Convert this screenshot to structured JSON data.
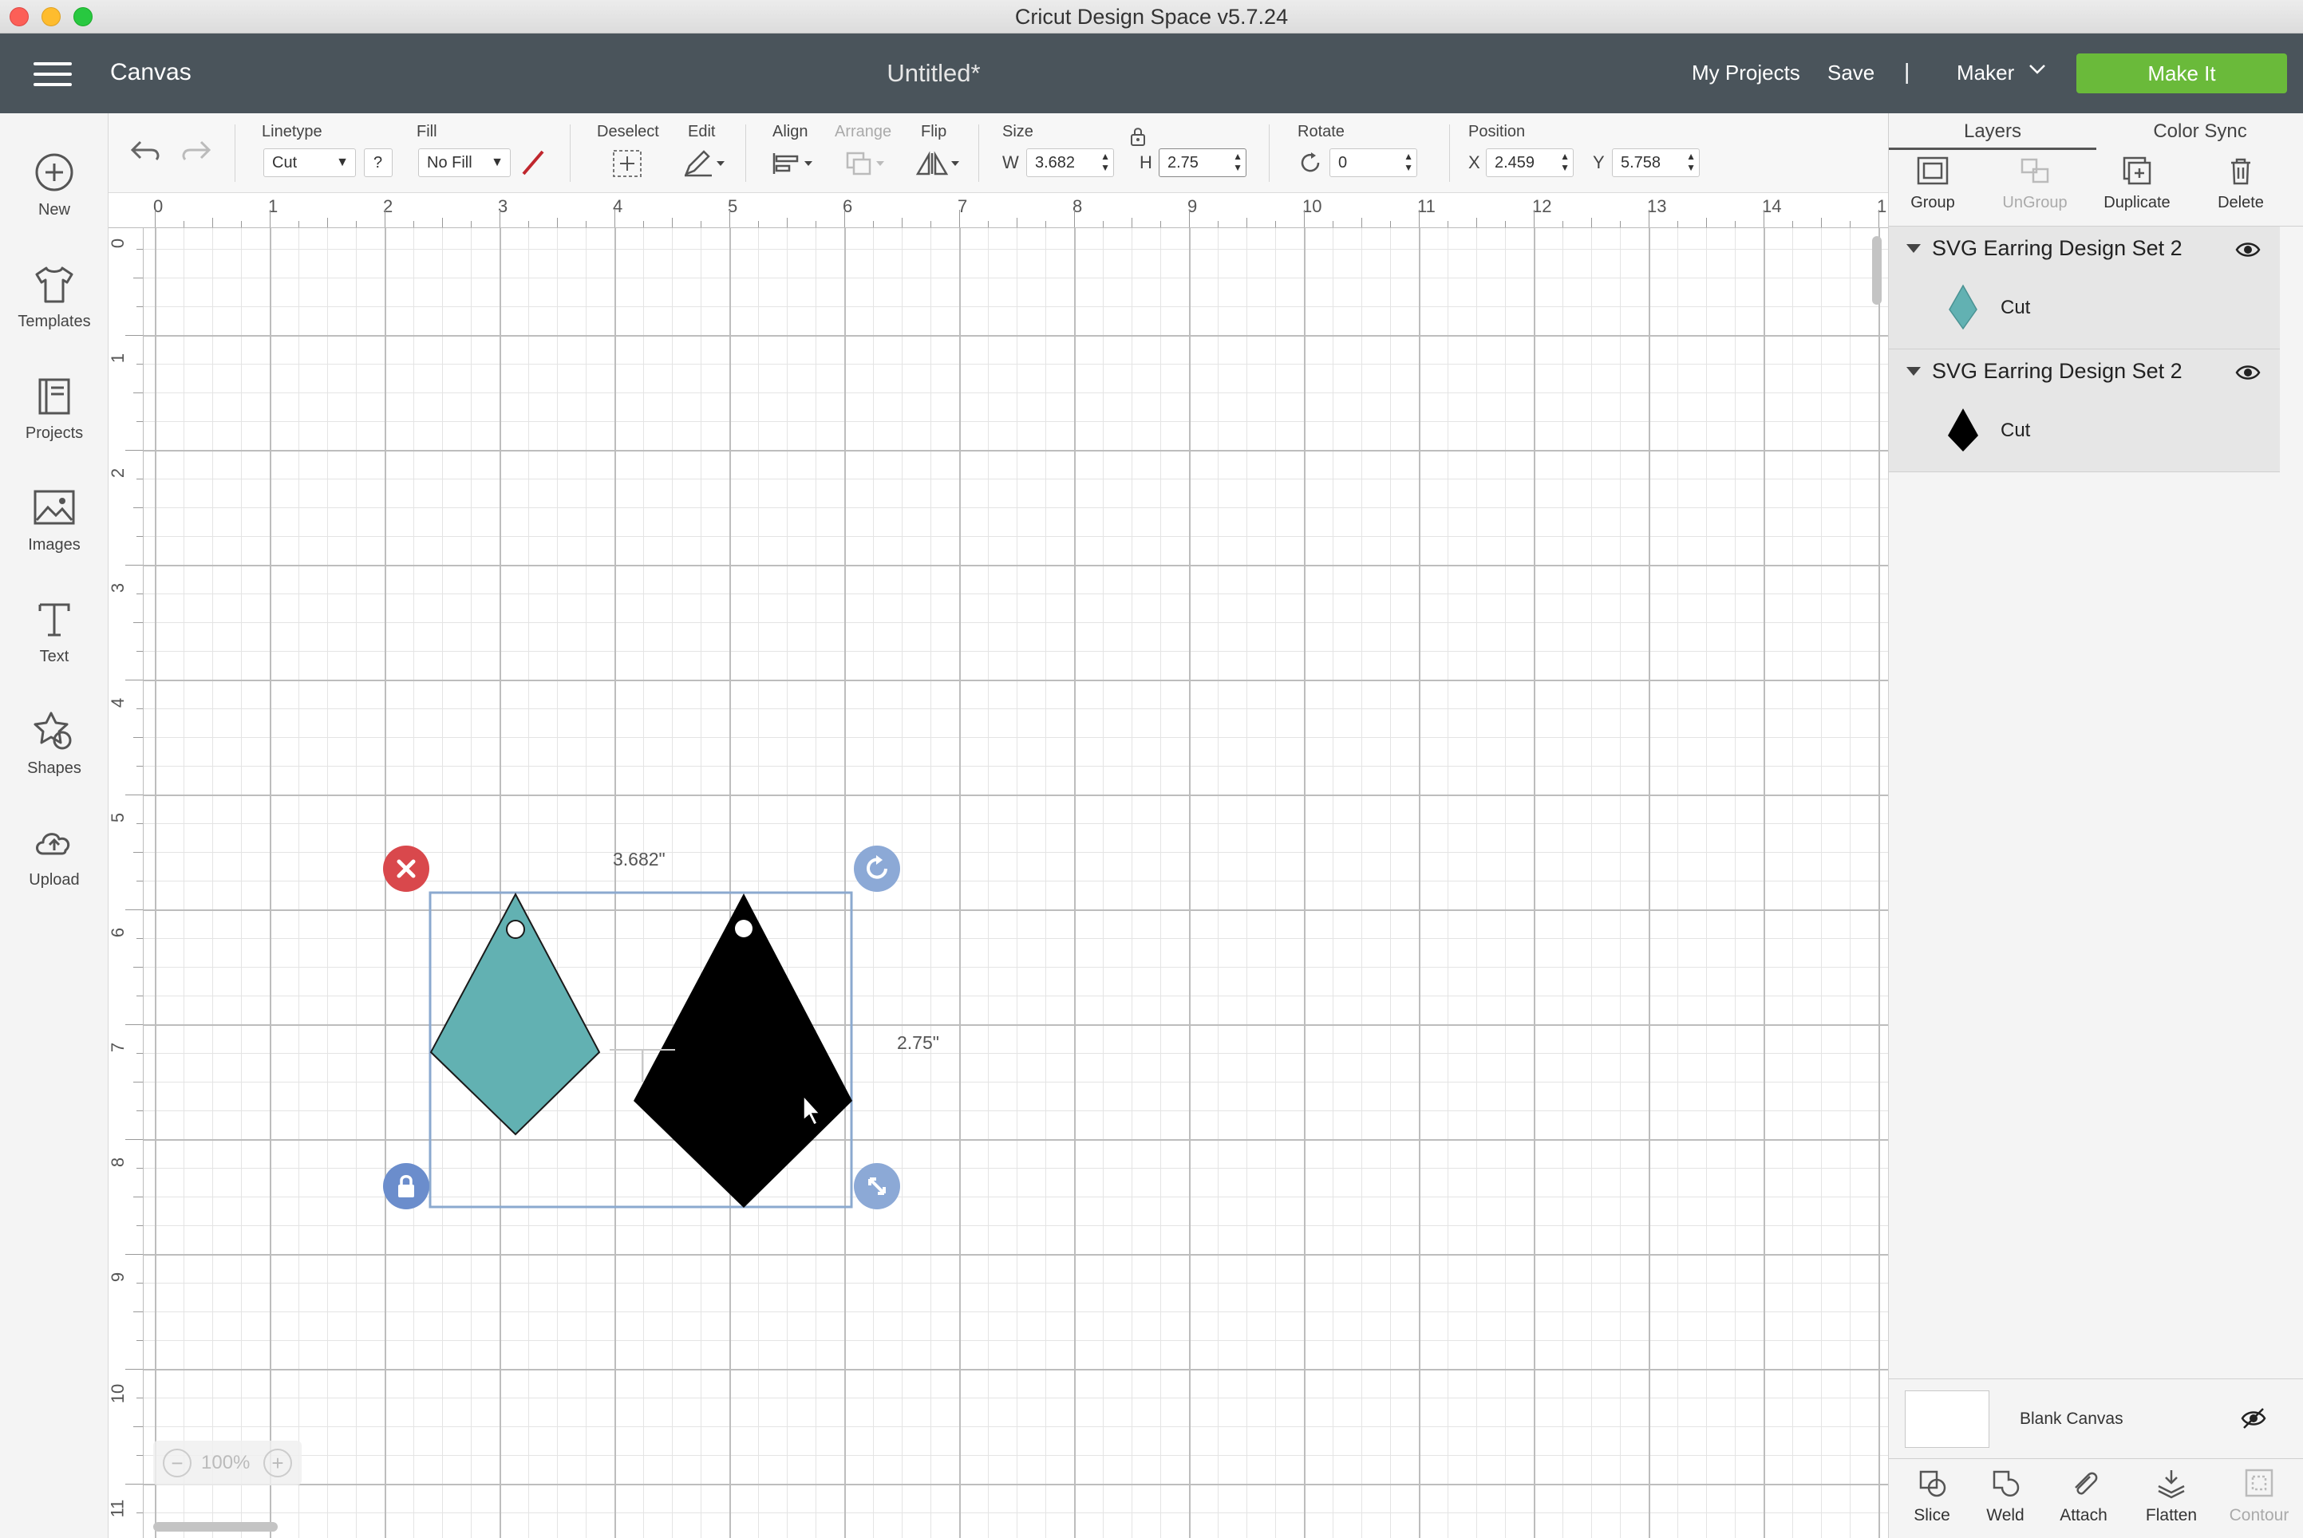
{
  "window": {
    "title": "Cricut Design Space  v5.7.24"
  },
  "header": {
    "section": "Canvas",
    "document_title": "Untitled*",
    "my_projects": "My Projects",
    "save": "Save",
    "separator": "|",
    "machine": "Maker",
    "make_it": "Make It"
  },
  "sidebar": {
    "items": [
      {
        "label": "New",
        "icon": "plus-circle-icon"
      },
      {
        "label": "Templates",
        "icon": "tshirt-icon"
      },
      {
        "label": "Projects",
        "icon": "projects-icon"
      },
      {
        "label": "Images",
        "icon": "image-icon"
      },
      {
        "label": "Text",
        "icon": "text-icon"
      },
      {
        "label": "Shapes",
        "icon": "shapes-icon"
      },
      {
        "label": "Upload",
        "icon": "cloud-upload-icon"
      }
    ]
  },
  "toolbar": {
    "linetype_label": "Linetype",
    "linetype_value": "Cut",
    "help": "?",
    "fill_label": "Fill",
    "fill_value": "No Fill",
    "deselect_label": "Deselect",
    "edit_label": "Edit",
    "align_label": "Align",
    "arrange_label": "Arrange",
    "flip_label": "Flip",
    "size_label": "Size",
    "w_label": "W",
    "w_value": "3.682",
    "h_label": "H",
    "h_value": "2.75",
    "rotate_label": "Rotate",
    "rotate_value": "0",
    "position_label": "Position",
    "x_label": "X",
    "x_value": "2.459",
    "y_label": "Y",
    "y_value": "5.758"
  },
  "canvas": {
    "ruler_h": [
      "0",
      "1",
      "2",
      "3",
      "4",
      "5",
      "6",
      "7",
      "8",
      "9",
      "10",
      "11",
      "12",
      "13",
      "14",
      "1"
    ],
    "ruler_v": [
      "0",
      "1",
      "2",
      "3",
      "4",
      "5",
      "6",
      "7",
      "8",
      "9",
      "10",
      "11"
    ],
    "selection_width_label": "3.682\"",
    "selection_height_label": "2.75\"",
    "zoom": "100%",
    "zoom_minus": "−",
    "zoom_plus": "+",
    "shape_colors": {
      "teal": "#62b1b2",
      "black": "#000000"
    }
  },
  "panel": {
    "tabs": [
      "Layers",
      "Color Sync"
    ],
    "tools": [
      {
        "label": "Group",
        "enabled": true
      },
      {
        "label": "UnGroup",
        "enabled": false
      },
      {
        "label": "Duplicate",
        "enabled": true
      },
      {
        "label": "Delete",
        "enabled": true
      }
    ],
    "layers": [
      {
        "name": "SVG Earring Design Set 2",
        "item": "Cut",
        "color": "#62b1b2"
      },
      {
        "name": "SVG Earring Design Set 2",
        "item": "Cut",
        "color": "#000000"
      }
    ],
    "blank_canvas": "Blank Canvas",
    "bottom_tools": [
      {
        "label": "Slice",
        "enabled": true
      },
      {
        "label": "Weld",
        "enabled": true
      },
      {
        "label": "Attach",
        "enabled": true
      },
      {
        "label": "Flatten",
        "enabled": true
      },
      {
        "label": "Contour",
        "enabled": false
      }
    ]
  }
}
